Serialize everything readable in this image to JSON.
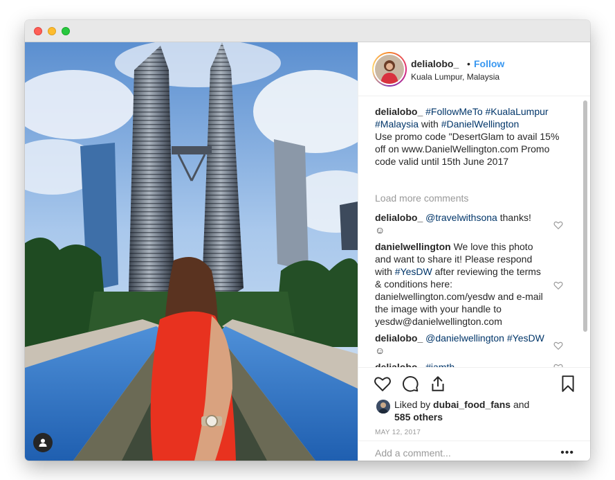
{
  "post": {
    "username": "delialobo_",
    "dot": "•",
    "follow_label": "Follow",
    "location": "Kuala Lumpur, Malaysia"
  },
  "caption": {
    "author": "delialobo_",
    "t1": "#FollowMeTo",
    "t2": "#KualaLumpur",
    "t3": "#Malaysia",
    "with": "with",
    "t4": "#DanielWellington",
    "body": "Use promo code \"DesertGlam to avail 15% off on www.DanielWellington.com Promo code valid until 15th June 2017"
  },
  "load_more": "Load more comments",
  "comments": [
    {
      "author": "delialobo_",
      "mention": "@travelwithsona",
      "text": "thanks!",
      "emoji": "☺"
    },
    {
      "author": "danielwellington",
      "pre": "We love this photo and want to share it! Please respond with",
      "tag": "#YesDW",
      "post": "after reviewing the terms & conditions here: danielwellington.com/yesdw and e-mail the image with your handle to yesdw@danielwellington.com"
    },
    {
      "author": "delialobo_",
      "mention": "@danielwellington",
      "tag": "#YesDW",
      "emoji": "☺"
    },
    {
      "author": "delialobo_",
      "tag": "#iamth"
    }
  ],
  "likes": {
    "prefix": "Liked by",
    "user": "dubai_food_fans",
    "and": "and",
    "others": "585 others"
  },
  "date": "MAY 12, 2017",
  "add_comment": {
    "placeholder": "Add a comment..."
  },
  "more": "•••",
  "icons": [
    "heart-icon",
    "comment-icon",
    "share-icon",
    "bookmark-icon",
    "user-icon",
    "small-heart-icon"
  ]
}
